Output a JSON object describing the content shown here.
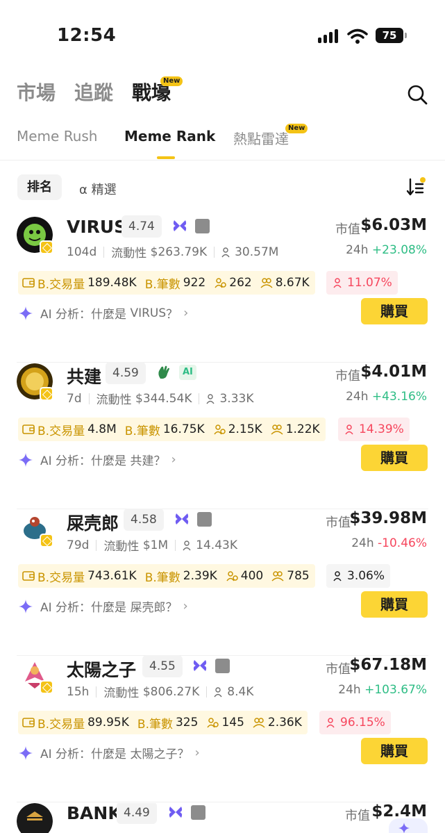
{
  "status": {
    "time": "12:54",
    "battery": "75"
  },
  "nav": {
    "tabs": [
      "市場",
      "追蹤",
      "戰壕"
    ],
    "new_badge": "New",
    "sub_tabs": [
      "Meme Rush",
      "Meme Rank",
      "熱點雷達"
    ],
    "sub_new_badge": "New"
  },
  "filters": {
    "rank": "排名",
    "featured": "α 精選"
  },
  "labels": {
    "mcap": "市值",
    "h24": "24h",
    "liquidity": "流動性",
    "b_volume": "B.交易量",
    "b_trades": "B.筆數",
    "ai_prefix": "AI 分析：什麼是",
    "ai_suffix": "？",
    "buy": "購買"
  },
  "colors": {
    "accent": "#FCD535",
    "up": "#2EBD85",
    "down": "#F6465D"
  },
  "tokens": [
    {
      "name": "VIRUS",
      "score": "4.74",
      "icon": "butterfly-icon",
      "mcap": "$6.03M",
      "age": "104d",
      "liquidity": "$263.79K",
      "holders": "30.57M",
      "change": "+23.08%",
      "trend": "up",
      "b_volume": "189.48K",
      "b_trades": "922",
      "smart": "262",
      "kol": "8.67K",
      "top_hold": "11.07%",
      "top_hold_style": "red",
      "ai_name": "VIRUS"
    },
    {
      "name": "共建",
      "score": "4.59",
      "icon": "hand-wave-icon",
      "ai_tag": "AI",
      "mcap": "$4.01M",
      "age": "7d",
      "liquidity": "$344.54K",
      "holders": "3.33K",
      "change": "+43.16%",
      "trend": "up",
      "b_volume": "4.8M",
      "b_trades": "16.75K",
      "smart": "2.15K",
      "kol": "1.22K",
      "top_hold": "14.39%",
      "top_hold_style": "red",
      "ai_name": "共建"
    },
    {
      "name": "屎壳郎",
      "score": "4.58",
      "icon": "butterfly-icon",
      "mcap": "$39.98M",
      "age": "79d",
      "liquidity": "$1M",
      "holders": "14.43K",
      "change": "-10.46%",
      "trend": "down",
      "b_volume": "743.61K",
      "b_trades": "2.39K",
      "smart": "400",
      "kol": "785",
      "top_hold": "3.06%",
      "top_hold_style": "plain",
      "ai_name": "屎壳郎"
    },
    {
      "name": "太陽之子",
      "score": "4.55",
      "icon": "butterfly-icon",
      "mcap": "$67.18M",
      "age": "15h",
      "liquidity": "$806.27K",
      "holders": "8.4K",
      "change": "+103.67%",
      "trend": "up",
      "b_volume": "89.95K",
      "b_trades": "325",
      "smart": "145",
      "kol": "2.36K",
      "top_hold": "96.15%",
      "top_hold_style": "red",
      "ai_name": "太陽之子"
    },
    {
      "name": "BANK",
      "score": "4.49",
      "icon": "butterfly-icon",
      "mcap": "$2.4M"
    }
  ]
}
